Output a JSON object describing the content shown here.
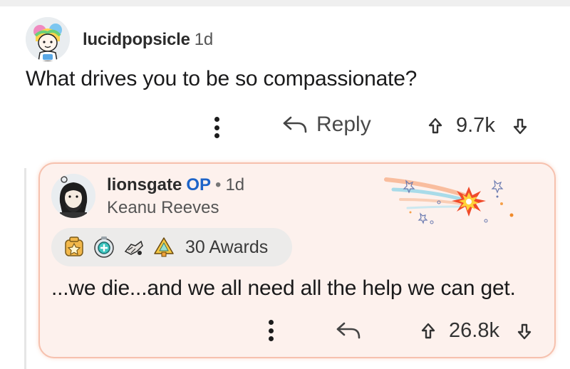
{
  "parent_comment": {
    "username": "lucidpopsicle",
    "time": "1d",
    "body": "What drives you to be so compassionate?",
    "reply_label": "Reply",
    "score": "9.7k"
  },
  "reply_comment": {
    "username": "lionsgate",
    "op_badge": "OP",
    "separator": "•",
    "time": "1d",
    "flair": "Keanu Reeves",
    "awards_label": "30 Awards",
    "award_icons": [
      "wholesome-seal-icon",
      "helpful-award-icon",
      "take-my-power-icon",
      "rocket-like-icon"
    ],
    "body": "...we die...and we all need all the help we can get.",
    "score": "26.8k"
  },
  "colors": {
    "op_blue": "#1e64c8",
    "card_background": "#fdf1ed",
    "card_border": "#f6c1ae"
  }
}
